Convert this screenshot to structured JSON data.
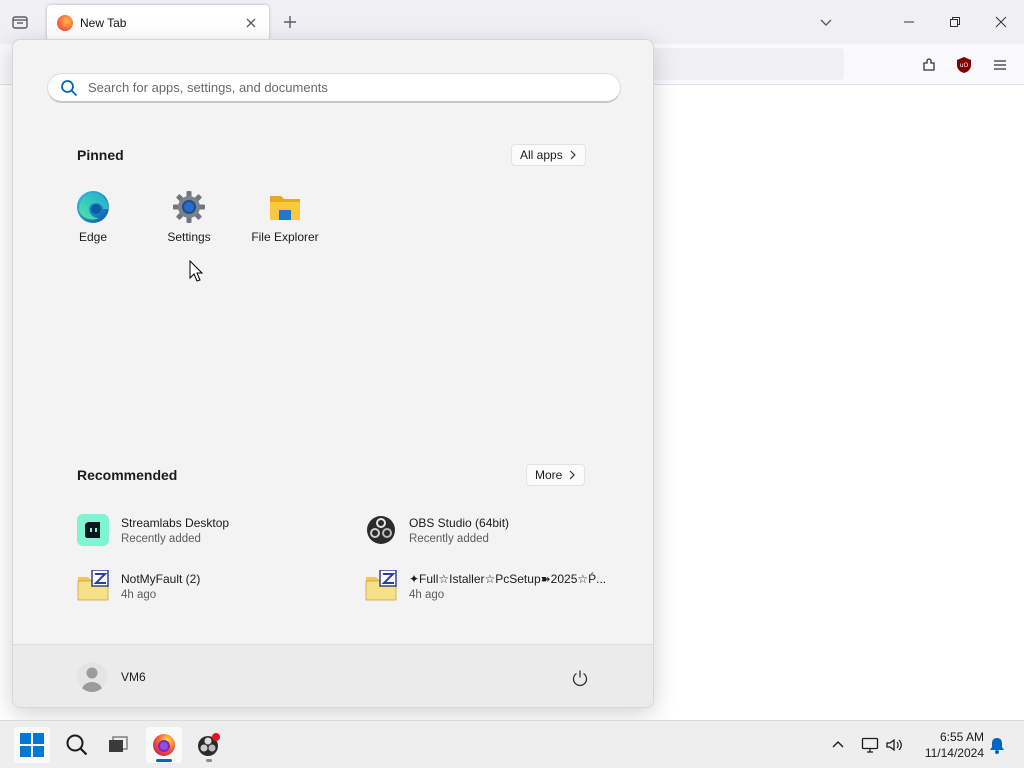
{
  "browser": {
    "tab_title": "New Tab"
  },
  "start_menu": {
    "search_placeholder": "Search for apps, settings, and documents",
    "pinned_title": "Pinned",
    "all_apps_label": "All apps",
    "pinned": [
      {
        "label": "Edge",
        "icon": "edge-icon"
      },
      {
        "label": "Settings",
        "icon": "gear-icon"
      },
      {
        "label": "File Explorer",
        "icon": "folder-icon"
      }
    ],
    "recommended_title": "Recommended",
    "more_label": "More",
    "recommended": [
      {
        "name": "Streamlabs Desktop",
        "sub": "Recently added",
        "icon": "streamlabs-icon"
      },
      {
        "name": "OBS Studio (64bit)",
        "sub": "Recently added",
        "icon": "obs-icon"
      },
      {
        "name": "NotMyFault (2)",
        "sub": "4h ago",
        "icon": "zip-folder-icon"
      },
      {
        "name": "✦Full☆Istaller☆PcSetup➽2025☆Ṕ...",
        "sub": "4h ago",
        "icon": "zip-folder-icon"
      }
    ],
    "user_name": "VM6"
  },
  "taskbar": {
    "time": "6:55 AM",
    "date": "11/14/2024"
  },
  "colors": {
    "accent": "#0067c0",
    "firefox_indicator": "#0067c0"
  }
}
